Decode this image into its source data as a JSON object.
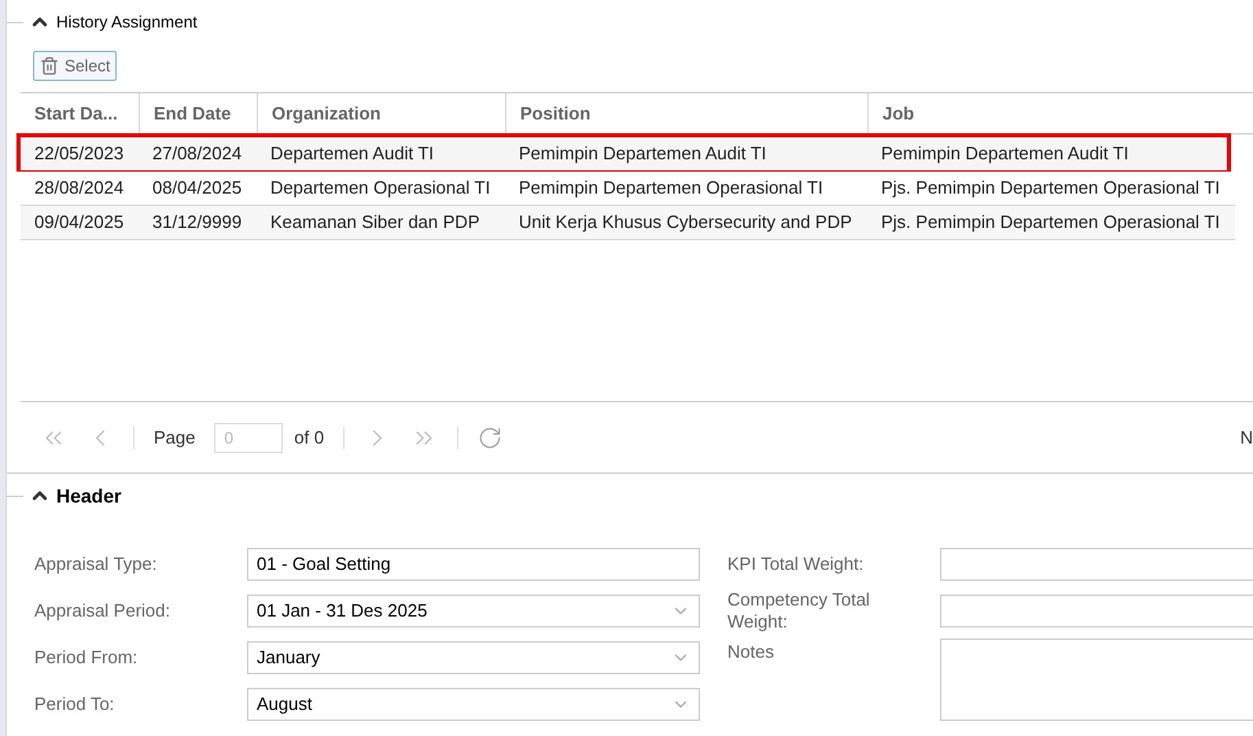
{
  "history": {
    "title": "History Assignment",
    "expanded": true,
    "toolbar_button": "Select",
    "columns": [
      "Start Da...",
      "End Date",
      "Organization",
      "Position",
      "Job"
    ],
    "rows": [
      {
        "cells": [
          "22/05/2023",
          "27/08/2024",
          "Departemen Audit TI",
          "Pemimpin Departemen Audit TI",
          "Pemimpin Departemen Audit TI"
        ],
        "selected": true
      },
      {
        "cells": [
          "28/08/2024",
          "08/04/2025",
          "Departemen Operasional TI",
          "Pemimpin Departemen Operasional TI",
          "Pjs. Pemimpin Departemen Operasional TI"
        ],
        "selected": false
      },
      {
        "cells": [
          "09/04/2025",
          "31/12/9999",
          "Keamanan Siber dan PDP",
          "Unit Kerja Khusus Cybersecurity and PDP",
          "Pjs. Pemimpin Departemen Operasional TI"
        ],
        "selected": false
      }
    ],
    "pager": {
      "page_label": "Page",
      "page_value": "0",
      "of_label": "of 0",
      "right_text": "N"
    }
  },
  "header": {
    "title": "Header",
    "expanded": true,
    "left_fields": [
      {
        "label": "Appraisal Type:",
        "value": "01 - Goal Setting",
        "kind": "text"
      },
      {
        "label": "Appraisal Period:",
        "value": "01 Jan - 31 Des 2025",
        "kind": "select"
      },
      {
        "label": "Period From:",
        "value": "January",
        "kind": "select"
      },
      {
        "label": "Period To:",
        "value": "August",
        "kind": "select"
      }
    ],
    "right_fields": [
      {
        "label": "KPI Total Weight:",
        "kind": "text"
      },
      {
        "label": "Competency Total Weight:",
        "kind": "text"
      },
      {
        "label": "Notes",
        "kind": "textarea"
      }
    ]
  }
}
